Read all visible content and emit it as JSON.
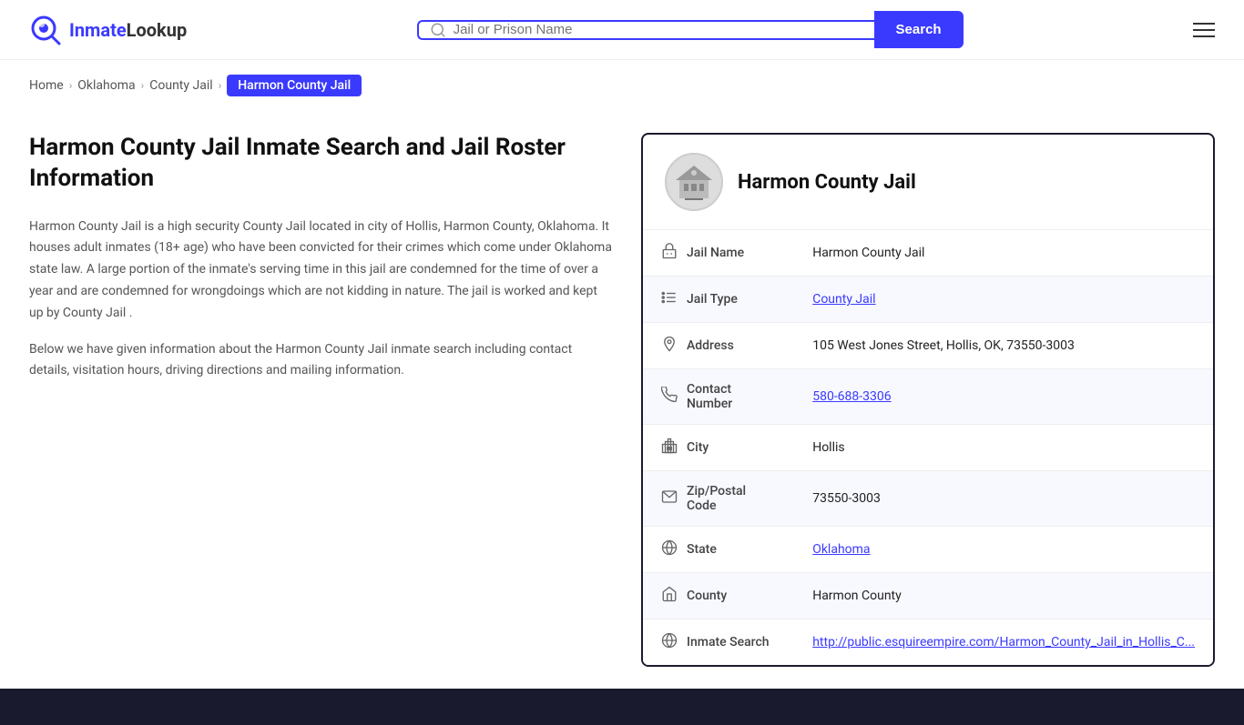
{
  "header": {
    "logo_text_blue": "Inmate",
    "logo_text_dark": "Lookup",
    "search_placeholder": "Jail or Prison Name",
    "search_button_label": "Search"
  },
  "breadcrumb": {
    "home": "Home",
    "state": "Oklahoma",
    "type": "County Jail",
    "current": "Harmon County Jail"
  },
  "main": {
    "page_title": "Harmon County Jail Inmate Search and Jail Roster Information",
    "description1": "Harmon County Jail is a high security County Jail located in city of Hollis, Harmon County, Oklahoma. It houses adult inmates (18+ age) who have been convicted for their crimes which come under Oklahoma state law. A large portion of the inmate's serving time in this jail are condemned for the time of over a year and are condemned for wrongdoings which are not kidding in nature. The jail is worked and kept up by County Jail .",
    "description2": "Below we have given information about the Harmon County Jail inmate search including contact details, visitation hours, driving directions and mailing information."
  },
  "info_card": {
    "title": "Harmon County Jail",
    "rows": [
      {
        "label": "Jail Name",
        "value": "Harmon County Jail",
        "link": false,
        "icon": "jail-icon"
      },
      {
        "label": "Jail Type",
        "value": "County Jail",
        "link": true,
        "link_url": "#",
        "icon": "list-icon"
      },
      {
        "label": "Address",
        "value": "105 West Jones Street, Hollis, OK, 73550-3003",
        "link": false,
        "icon": "location-icon"
      },
      {
        "label": "Contact Number",
        "value": "580-688-3306",
        "link": true,
        "link_url": "tel:580-688-3306",
        "icon": "phone-icon"
      },
      {
        "label": "City",
        "value": "Hollis",
        "link": false,
        "icon": "city-icon"
      },
      {
        "label": "Zip/Postal Code",
        "value": "73550-3003",
        "link": false,
        "icon": "mail-icon"
      },
      {
        "label": "State",
        "value": "Oklahoma",
        "link": true,
        "link_url": "#",
        "icon": "globe-icon"
      },
      {
        "label": "County",
        "value": "Harmon County",
        "link": false,
        "icon": "county-icon"
      },
      {
        "label": "Inmate Search",
        "value": "http://public.esquireempire.com/Harmon_County_Jail_in_Hollis_C...",
        "link": true,
        "link_url": "http://public.esquireempire.com/Harmon_County_Jail_in_Hollis_C",
        "icon": "search-globe-icon"
      }
    ]
  }
}
